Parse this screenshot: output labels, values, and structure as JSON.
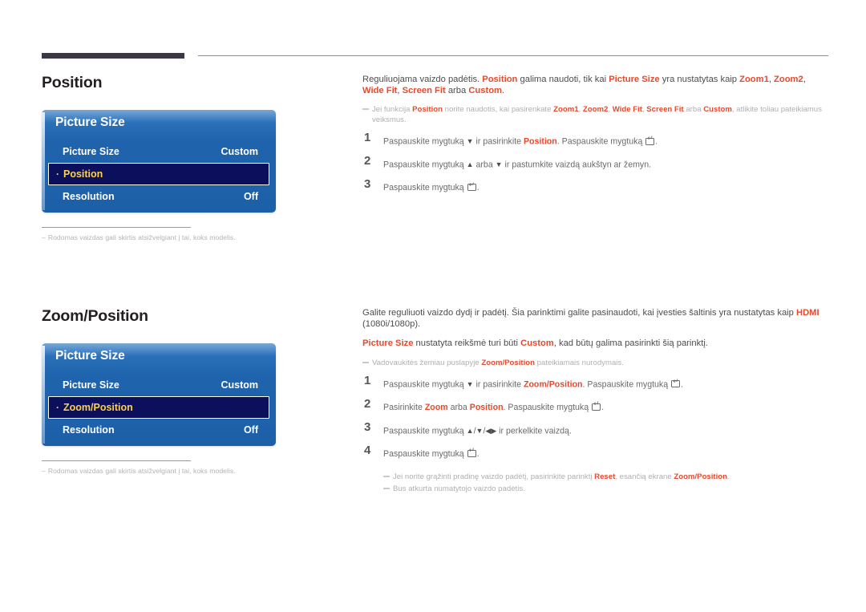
{
  "page": {
    "background": "#ffffff",
    "accent_red": "#e8492c",
    "osd_blue": "#1f63ad",
    "osd_highlight": "#0b0f5c",
    "osd_highlight_text": "#ffd24a"
  },
  "sections": [
    {
      "id": "position",
      "title": "Position",
      "osd": {
        "title": "Picture Size",
        "rows": [
          {
            "label": "Picture Size",
            "value": "Custom",
            "selected": false
          },
          {
            "label": "Position",
            "value": "",
            "selected": true
          },
          {
            "label": "Resolution",
            "value": "Off",
            "selected": false
          }
        ]
      },
      "panel_note": {
        "dash": "–",
        "text": "Rodomas vaizdas gali skirtis atsižvelgiant į tai, koks modelis."
      },
      "intro": [
        {
          "t": "Reguliuojama vaizdo padėtis. "
        },
        {
          "t": "Position",
          "hl": true
        },
        {
          "t": " galima naudoti, tik kai "
        },
        {
          "t": "Picture Size",
          "hl": true
        },
        {
          "t": " yra nustatytas kaip "
        },
        {
          "t": "Zoom1",
          "hl": true
        },
        {
          "t": ", "
        },
        {
          "t": "Zoom2",
          "hl": true
        },
        {
          "t": ", "
        },
        {
          "t": "Wide Fit",
          "hl": true
        },
        {
          "t": ", "
        },
        {
          "t": "Screen Fit",
          "hl": true
        },
        {
          "t": " arba "
        },
        {
          "t": "Custom",
          "hl": true
        },
        {
          "t": "."
        }
      ],
      "note": [
        {
          "t": "Jei funkcija "
        },
        {
          "t": "Position",
          "hl": true
        },
        {
          "t": " norite naudotis, kai pasirenkate "
        },
        {
          "t": "Zoom1",
          "hl": true
        },
        {
          "t": ", "
        },
        {
          "t": "Zoom2",
          "hl": true
        },
        {
          "t": ", "
        },
        {
          "t": "Wide Fit",
          "hl": true
        },
        {
          "t": ", "
        },
        {
          "t": "Screen Fit",
          "hl": true
        },
        {
          "t": " arba "
        },
        {
          "t": "Custom",
          "hl": true
        },
        {
          "t": ", atlikite toliau pateikiamus veiksmus."
        }
      ],
      "steps": [
        {
          "num": "1",
          "parts": [
            {
              "t": "Paspauskite mygtuką "
            },
            {
              "icon": "arrow-down"
            },
            {
              "t": " ir pasirinkite "
            },
            {
              "t": "Position",
              "hl": true
            },
            {
              "t": ". Paspauskite mygtuką "
            },
            {
              "icon": "enter-key"
            },
            {
              "t": "."
            }
          ]
        },
        {
          "num": "2",
          "parts": [
            {
              "t": "Paspauskite mygtuką "
            },
            {
              "icon": "arrow-up"
            },
            {
              "t": " arba "
            },
            {
              "icon": "arrow-down"
            },
            {
              "t": " ir pastumkite vaizdą aukštyn ar žemyn."
            }
          ]
        },
        {
          "num": "3",
          "parts": [
            {
              "t": "Paspauskite mygtuką "
            },
            {
              "icon": "enter-key"
            },
            {
              "t": "."
            }
          ]
        }
      ],
      "tail_notes": []
    },
    {
      "id": "zoom-position",
      "title": "Zoom/Position",
      "osd": {
        "title": "Picture Size",
        "rows": [
          {
            "label": "Picture Size",
            "value": "Custom",
            "selected": false
          },
          {
            "label": "Zoom/Position",
            "value": "",
            "selected": true
          },
          {
            "label": "Resolution",
            "value": "Off",
            "selected": false
          }
        ]
      },
      "panel_note": {
        "dash": "–",
        "text": "Rodomas vaizdas gali skirtis atsižvelgiant į tai, koks modelis."
      },
      "intro": [
        {
          "t": "Galite reguliuoti vaizdo dydį ir padėtį. Šia parinktimi galite pasinaudoti, kai įvesties šaltinis yra nustatytas kaip "
        },
        {
          "t": "HDMI",
          "hl": true
        },
        {
          "t": " (1080i/1080p)."
        }
      ],
      "intro2": [
        {
          "t": "Picture Size",
          "hl": true
        },
        {
          "t": " nustatyta reikšmė turi būti "
        },
        {
          "t": "Custom",
          "hl": true
        },
        {
          "t": ", kad būtų galima pasirinkti šią parinktį."
        }
      ],
      "note": [
        {
          "t": "Vadovaukitės žemiau puslapyje "
        },
        {
          "t": "Zoom/Position",
          "hl": true
        },
        {
          "t": " pateikiamais nurodymais."
        }
      ],
      "steps": [
        {
          "num": "1",
          "parts": [
            {
              "t": "Paspauskite mygtuką "
            },
            {
              "icon": "arrow-down"
            },
            {
              "t": " ir pasirinkite "
            },
            {
              "t": "Zoom/Position",
              "hl": true
            },
            {
              "t": ". Paspauskite mygtuką "
            },
            {
              "icon": "enter-key"
            },
            {
              "t": "."
            }
          ]
        },
        {
          "num": "2",
          "parts": [
            {
              "t": "Pasirinkite "
            },
            {
              "t": "Zoom",
              "hl": true
            },
            {
              "t": " arba "
            },
            {
              "t": "Position",
              "hl": true
            },
            {
              "t": ". Paspauskite mygtuką "
            },
            {
              "icon": "enter-key"
            },
            {
              "t": "."
            }
          ]
        },
        {
          "num": "3",
          "parts": [
            {
              "t": "Paspauskite mygtuką "
            },
            {
              "icon": "arrow-up"
            },
            {
              "t": "/"
            },
            {
              "icon": "arrow-down"
            },
            {
              "t": "/"
            },
            {
              "icon": "arrow-left"
            },
            {
              "icon": "arrow-right"
            },
            {
              "t": " ir perkelkite vaizdą."
            }
          ]
        },
        {
          "num": "4",
          "parts": [
            {
              "t": "Paspauskite mygtuką "
            },
            {
              "icon": "enter-key"
            },
            {
              "t": "."
            }
          ]
        }
      ],
      "tail_notes": [
        [
          {
            "t": "Jei norite grąžinti pradinę vaizdo padėtį, pasirinkite parinktį "
          },
          {
            "t": "Reset",
            "hl": true
          },
          {
            "t": ", esančią ekrane "
          },
          {
            "t": "Zoom/Position",
            "hl": true
          },
          {
            "t": "."
          }
        ],
        [
          {
            "t": "Bus atkurta numatytojo vaizdo padėtis."
          }
        ]
      ]
    }
  ],
  "icons": {
    "arrow-up": "▲",
    "arrow-down": "▼",
    "arrow-left": "◀",
    "arrow-right": "▶",
    "enter-key": "enter-key"
  }
}
